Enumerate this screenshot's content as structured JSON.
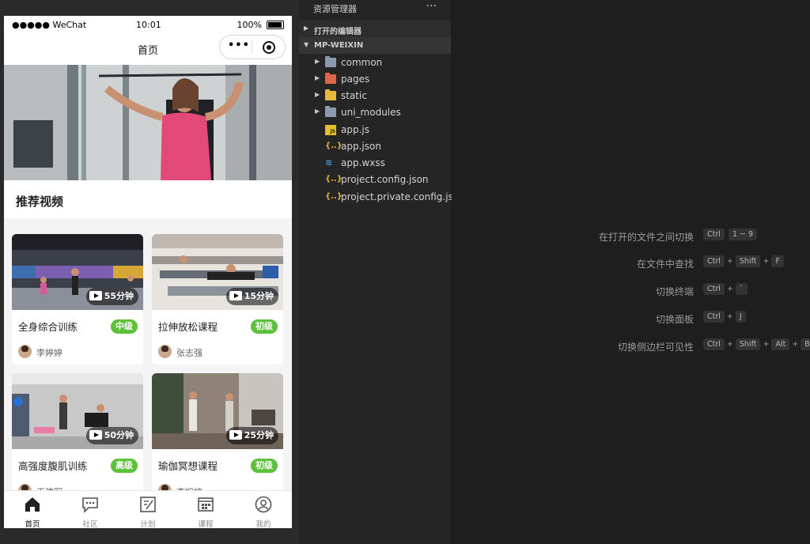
{
  "simulator": {
    "status": {
      "carrier": "●●●●● WeChat",
      "time": "10:01",
      "battery": "100%"
    },
    "nav": {
      "title": "首页"
    },
    "section_title": "推荐视频",
    "cards": [
      {
        "title": "全身综合训练",
        "duration": "55分钟",
        "level": "中级",
        "author": "李婷婷"
      },
      {
        "title": "拉伸放松课程",
        "duration": "15分钟",
        "level": "初级",
        "author": "张志强"
      },
      {
        "title": "高强度腹肌训练",
        "duration": "50分钟",
        "level": "高级",
        "author": "王建军"
      },
      {
        "title": "瑜伽冥想课程",
        "duration": "25分钟",
        "level": "初级",
        "author": "李婉婷"
      }
    ],
    "tabs": [
      {
        "label": "首页",
        "icon": "home-icon"
      },
      {
        "label": "社区",
        "icon": "community-icon"
      },
      {
        "label": "计划",
        "icon": "plan-icon"
      },
      {
        "label": "课程",
        "icon": "course-icon"
      },
      {
        "label": "我的",
        "icon": "profile-icon"
      }
    ]
  },
  "explorer": {
    "title": "资源管理器",
    "more": "···",
    "open_editors": "打开的编辑器",
    "project": "MP-WEIXIN",
    "items": [
      {
        "name": "common",
        "type": "folder",
        "color": "#8a9bb0"
      },
      {
        "name": "pages",
        "type": "folder",
        "color": "#e0654a"
      },
      {
        "name": "static",
        "type": "folder",
        "color": "#e8b93a"
      },
      {
        "name": "uni_modules",
        "type": "folder",
        "color": "#8a9bb0"
      },
      {
        "name": "app.js",
        "type": "js"
      },
      {
        "name": "app.json",
        "type": "json"
      },
      {
        "name": "app.wxss",
        "type": "css"
      },
      {
        "name": "project.config.json",
        "type": "json"
      },
      {
        "name": "project.private.config.js...",
        "type": "json"
      }
    ]
  },
  "shortcuts": [
    {
      "label": "在打开的文件之间切换",
      "keys": [
        "Ctrl",
        "1 ~ 9"
      ]
    },
    {
      "label": "在文件中查找",
      "keys": [
        "Ctrl",
        "+",
        "Shift",
        "+",
        "F"
      ]
    },
    {
      "label": "切换终端",
      "keys": [
        "Ctrl",
        "+",
        "`"
      ]
    },
    {
      "label": "切换面板",
      "keys": [
        "Ctrl",
        "+",
        "J"
      ]
    },
    {
      "label": "切换侧边栏可见性",
      "keys": [
        "Ctrl",
        "+",
        "Shift",
        "+",
        "Alt",
        "+",
        "B"
      ]
    }
  ]
}
